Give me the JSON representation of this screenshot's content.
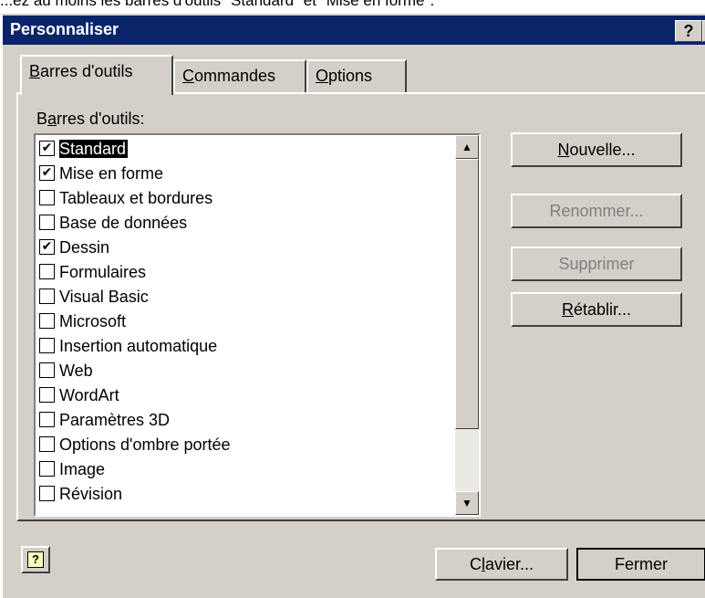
{
  "top_caption": "...ez au moins les barres d'outils \"Standard\" et \"Mise en forme\".",
  "dialog": {
    "title": "Personnaliser",
    "help_button": "?",
    "close_button": "×"
  },
  "tabs": [
    {
      "label": "Barres d'outils",
      "accel": "B",
      "active": true
    },
    {
      "label": "Commandes",
      "accel": "C",
      "active": false
    },
    {
      "label": "Options",
      "accel": "O",
      "active": false
    }
  ],
  "list": {
    "label": "Barres d'outils:",
    "items": [
      {
        "label": "Standard",
        "checked": true,
        "selected": true
      },
      {
        "label": "Mise en forme",
        "checked": true
      },
      {
        "label": "Tableaux et bordures",
        "checked": false
      },
      {
        "label": "Base de données",
        "checked": false
      },
      {
        "label": "Dessin",
        "checked": true
      },
      {
        "label": "Formulaires",
        "checked": false
      },
      {
        "label": "Visual Basic",
        "checked": false
      },
      {
        "label": "Microsoft",
        "checked": false
      },
      {
        "label": "Insertion automatique",
        "checked": false
      },
      {
        "label": "Web",
        "checked": false
      },
      {
        "label": "WordArt",
        "checked": false
      },
      {
        "label": "Paramètres 3D",
        "checked": false
      },
      {
        "label": "Options d'ombre portée",
        "checked": false
      },
      {
        "label": "Image",
        "checked": false
      },
      {
        "label": "Révision",
        "checked": false
      }
    ],
    "scroll_up": "▲",
    "scroll_down": "▼"
  },
  "buttons": {
    "nouvelle": "Nouvelle...",
    "renommer": "Renommer...",
    "supprimer": "Supprimer",
    "retablir": "Rétablir...",
    "clavier": "Clavier...",
    "fermer": "Fermer",
    "help_icon": "?"
  },
  "colors": {
    "titlebar": "#0a246a",
    "face": "#d4d0c8",
    "disabled_text": "#808080"
  }
}
